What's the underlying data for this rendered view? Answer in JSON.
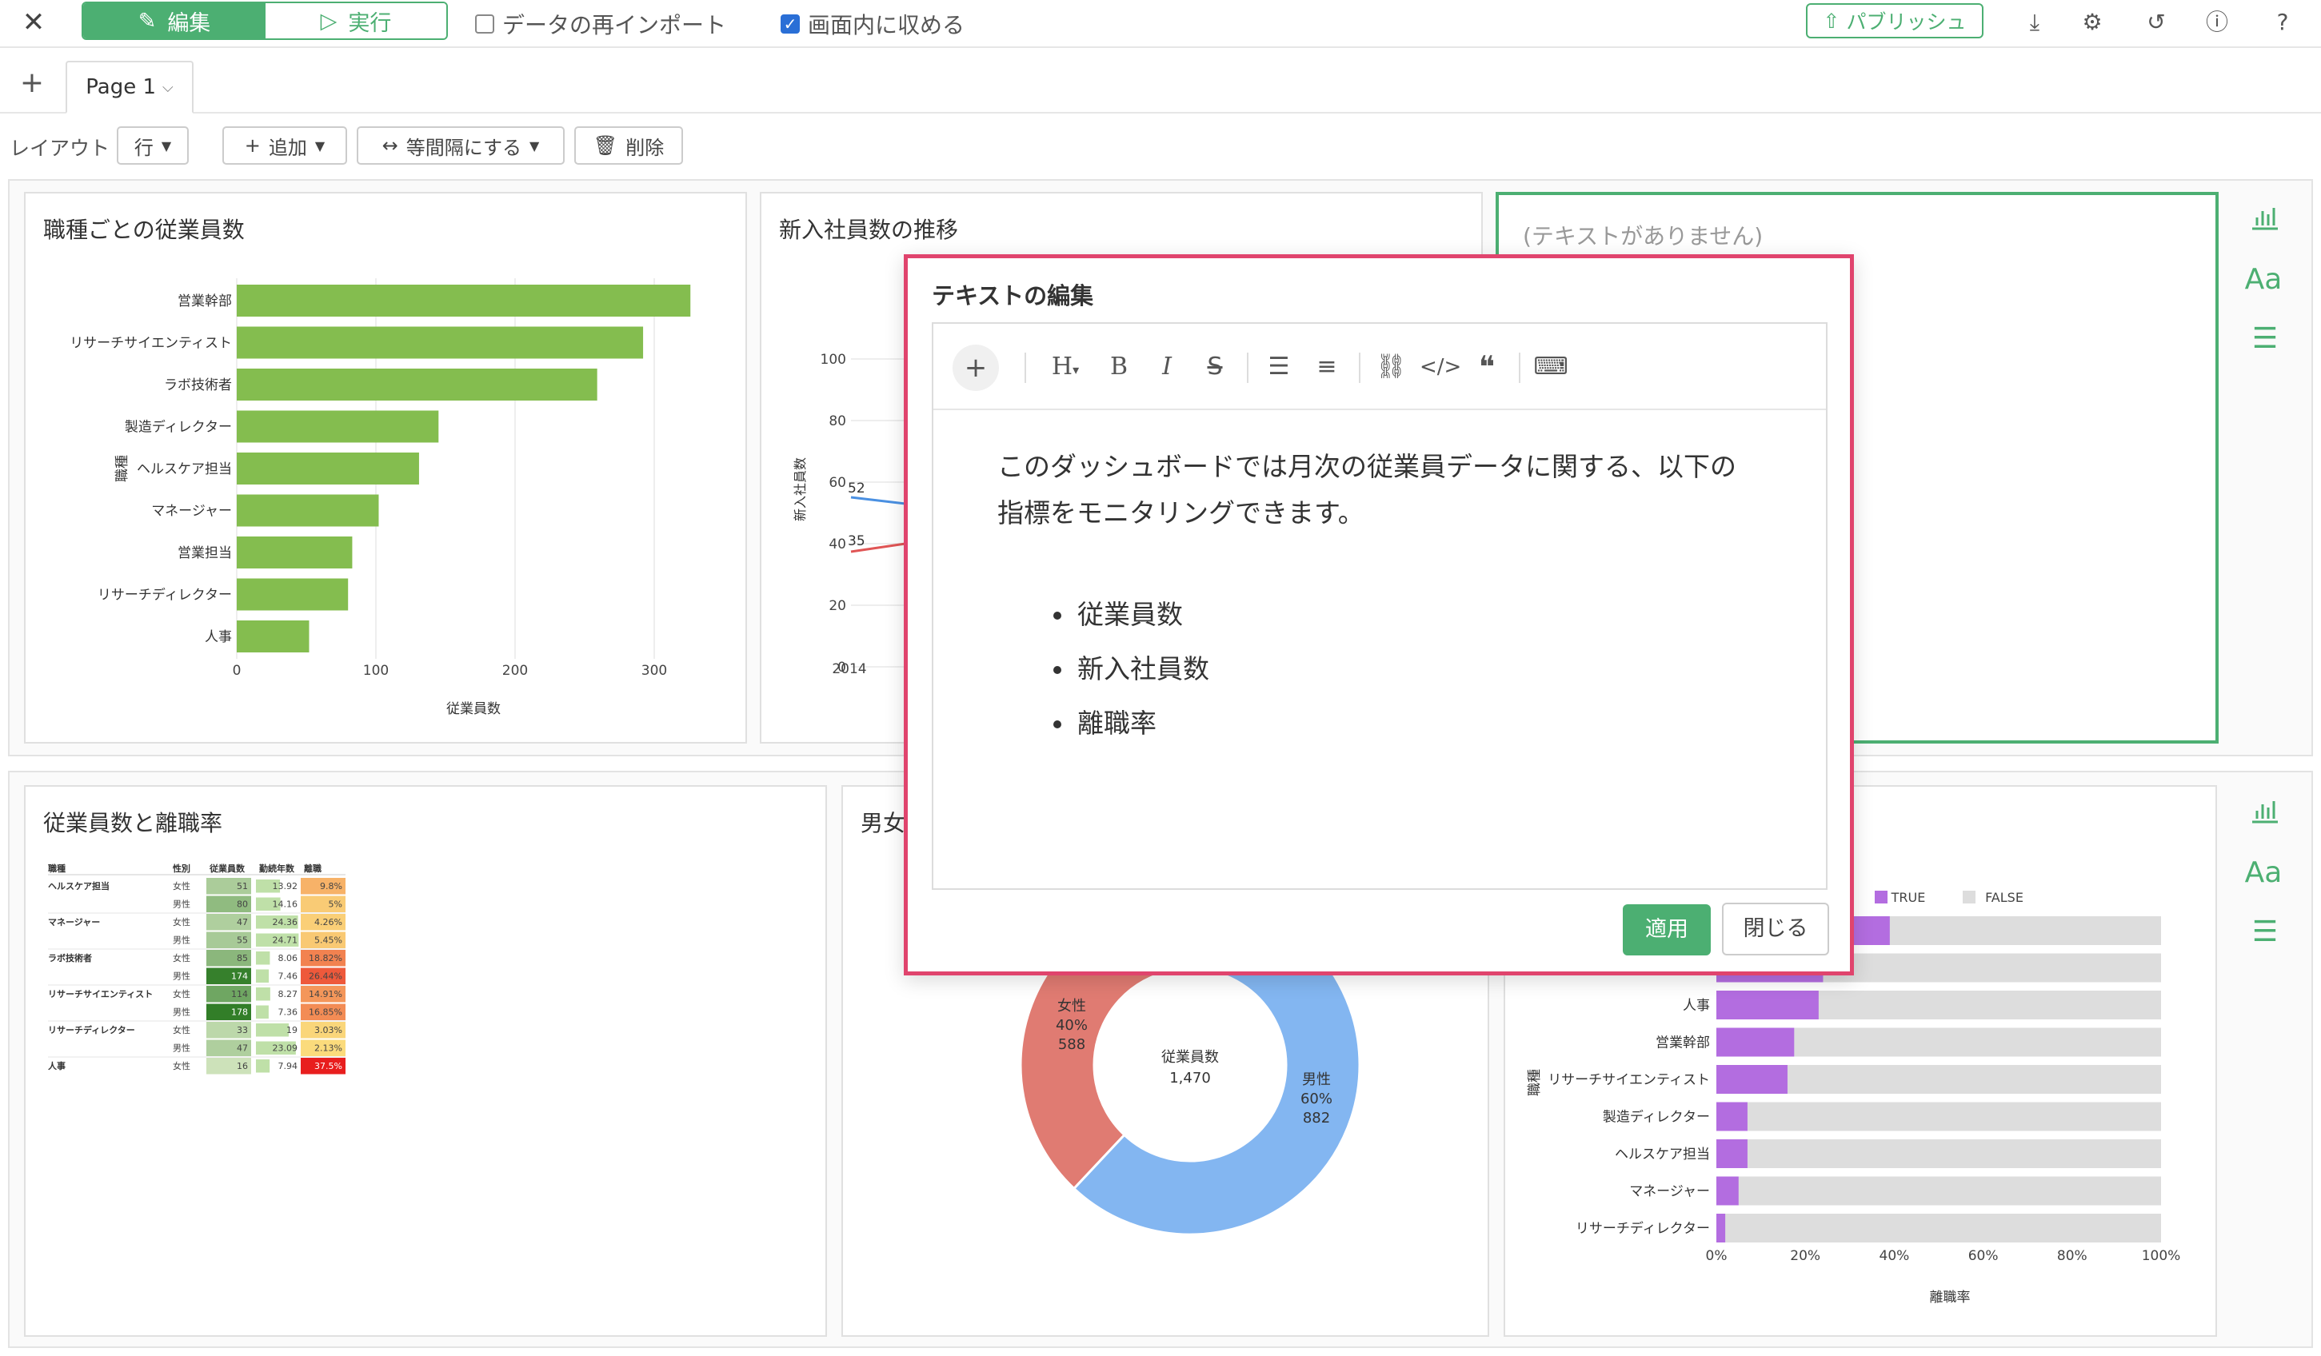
{
  "topbar": {
    "edit_label": "編集",
    "run_label": "実行",
    "reimport_label": "データの再インポート",
    "fit_label": "画面内に収める",
    "publish_label": "パブリッシュ"
  },
  "tabs": {
    "page_label": "Page 1"
  },
  "layout_toolbar": {
    "label": "レイアウト",
    "row_label": "行",
    "add_label": "追加",
    "equal_label": "等間隔にする",
    "delete_label": "削除"
  },
  "panels": {
    "p1_title": "職種ごとの従業員数",
    "p2_title": "新入社員数の推移",
    "p3_placeholder": "(テキストがありません)",
    "p4_title": "従業員数と離職率",
    "p5_title": "男女",
    "side_text_icon": "Aa"
  },
  "chart_data": [
    {
      "type": "bar",
      "orientation": "horizontal",
      "categories": [
        "営業幹部",
        "リサーチサイエンティスト",
        "ラボ技術者",
        "製造ディレクター",
        "ヘルスケア担当",
        "マネージャー",
        "営業担当",
        "リサーチディレクター",
        "人事"
      ],
      "values": [
        326,
        292,
        259,
        145,
        131,
        102,
        83,
        80,
        52
      ],
      "xlabel": "従業員数",
      "ylabel": "職種",
      "xticks": [
        "0",
        "100",
        "200",
        "300"
      ],
      "xlim": [
        0,
        340
      ],
      "color": "#84bd4f"
    },
    {
      "type": "line",
      "yticks": [
        "0",
        "20",
        "40",
        "60",
        "80",
        "100"
      ],
      "ylabel": "新入社員数",
      "x_first": "2014",
      "visible_labels": [
        "52",
        "35"
      ],
      "series_colors": [
        "#4a90e2",
        "#e05555"
      ]
    },
    {
      "type": "table",
      "columns": [
        "職種",
        "性別",
        "従業員数",
        "勤続年数",
        "離職"
      ],
      "rows": [
        [
          "ヘルスケア担当",
          "女性",
          "51",
          "13.92",
          "9.8%"
        ],
        [
          "",
          "男性",
          "80",
          "14.16",
          "5%"
        ],
        [
          "マネージャー",
          "女性",
          "47",
          "24.36",
          "4.26%"
        ],
        [
          "",
          "男性",
          "55",
          "24.71",
          "5.45%"
        ],
        [
          "ラボ技術者",
          "女性",
          "85",
          "8.06",
          "18.82%"
        ],
        [
          "",
          "男性",
          "174",
          "7.46",
          "26.44%"
        ],
        [
          "リサーチサイエンティスト",
          "女性",
          "114",
          "8.27",
          "14.91%"
        ],
        [
          "",
          "男性",
          "178",
          "7.36",
          "16.85%"
        ],
        [
          "リサーチディレクター",
          "女性",
          "33",
          "19",
          "3.03%"
        ],
        [
          "",
          "男性",
          "47",
          "23.09",
          "2.13%"
        ],
        [
          "人事",
          "女性",
          "16",
          "7.94",
          "37.5%"
        ]
      ]
    },
    {
      "type": "pie",
      "center_label": "従業員数",
      "center_value": "1,470",
      "slices": [
        {
          "label": "女性",
          "pct": "40%",
          "value": 588,
          "color": "#e07b72"
        },
        {
          "label": "男性",
          "pct": "60%",
          "value": 882,
          "color": "#83b6f1"
        }
      ]
    },
    {
      "type": "bar",
      "orientation": "horizontal",
      "stacked": "100%",
      "legend": [
        "TRUE",
        "FALSE"
      ],
      "legend_colors": [
        "#b36de0",
        "#dddddd"
      ],
      "categories": [
        "",
        "",
        "人事",
        "営業幹部",
        "リサーチサイエンティスト",
        "製造ディレクター",
        "ヘルスケア担当",
        "マネージャー",
        "リサーチディレクター"
      ],
      "true_pct": [
        39,
        24,
        23,
        17.5,
        16,
        7,
        7,
        5,
        2
      ],
      "xticks": [
        "0%",
        "20%",
        "40%",
        "60%",
        "80%",
        "100%"
      ],
      "xlabel": "離職率",
      "ylabel": "職種"
    }
  ],
  "modal": {
    "title": "テキストの編集",
    "body_line1": "このダッシュボードでは月次の従業員データに関する、以下の",
    "body_line2": "指標をモニタリングできます。",
    "bullets": [
      "従業員数",
      "新入社員数",
      "離職率"
    ],
    "apply_label": "適用",
    "close_label": "閉じる"
  }
}
